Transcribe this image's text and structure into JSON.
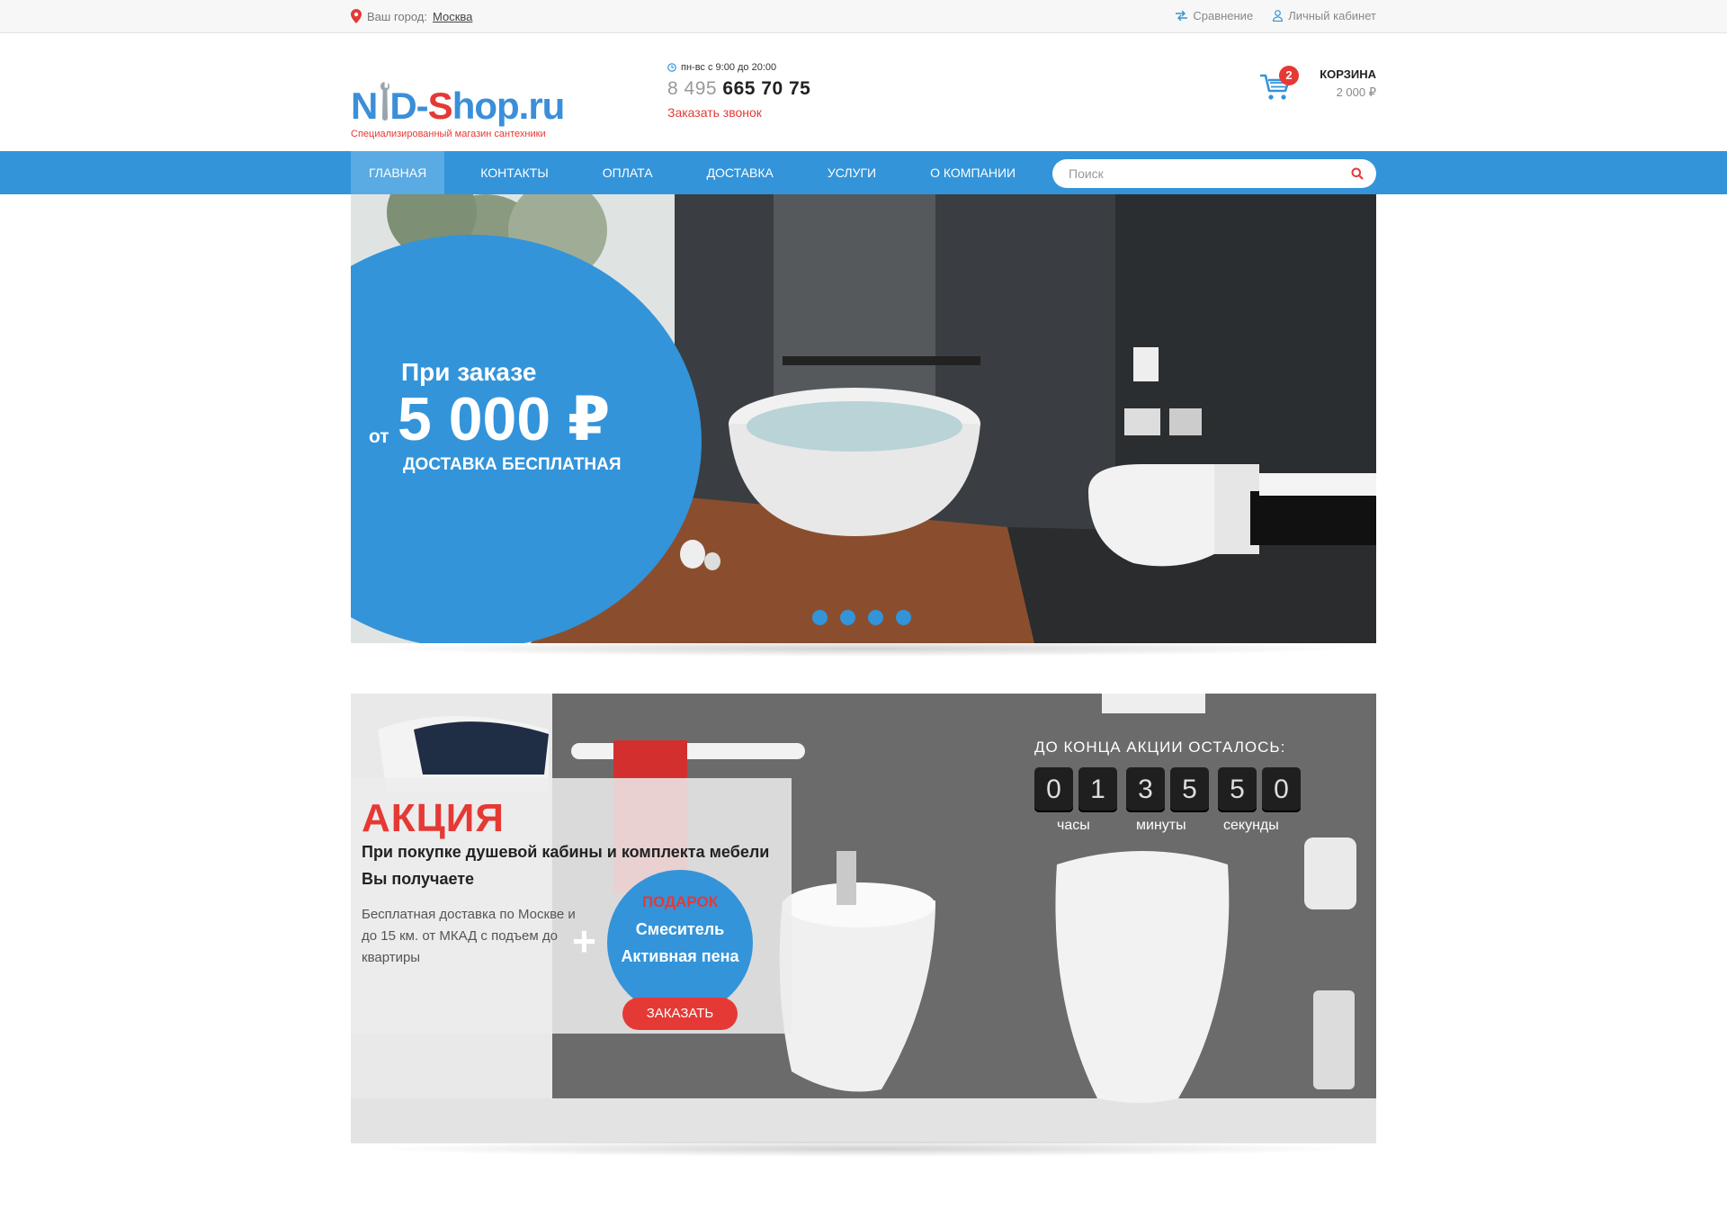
{
  "topbar": {
    "city_label": "Ваш город:",
    "city_value": "Москва",
    "compare": "Сравнение",
    "account": "Личный кабинет"
  },
  "header": {
    "logo_n": "N",
    "logo_d": "D-",
    "logo_s": "S",
    "logo_rest": "hop.ru",
    "logo_sub": "Специализированный магазин сантехники",
    "hours": "пн-вс с 9:00 до 20:00",
    "phone_code": "8 495",
    "phone_number": "665 70 75",
    "callback": "Заказать звонок",
    "cart_count": "2",
    "cart_title": "КОРЗИНА",
    "cart_sum": "2 000 ₽"
  },
  "nav": {
    "items": [
      {
        "label": "ГЛАВНАЯ"
      },
      {
        "label": "КОНТАКТЫ"
      },
      {
        "label": "ОПЛАТА"
      },
      {
        "label": "ДОСТАВКА"
      },
      {
        "label": "УСЛУГИ"
      },
      {
        "label": "О КОМПАНИИ"
      }
    ],
    "search_placeholder": "Поиск"
  },
  "hero": {
    "line1": "При заказе",
    "from": "от",
    "amount": "5 000 ₽",
    "line3": "ДОСТАВКА БЕСПЛАТНАЯ",
    "slides": 4
  },
  "promo": {
    "title": "АКЦИЯ",
    "line1": "При покупке душевой кабины и комплекта мебели",
    "line2": "Вы получаете",
    "desc": "Бесплатная доставка по Москве и до 15 км. от МКАД с подъем до квартиры",
    "plus": "+",
    "gift_title": "ПОДАРОК",
    "gift_1": "Смеситель",
    "gift_2": "Активная пена",
    "order": "ЗАКАЗАТЬ",
    "timer_title": "ДО КОНЦА АКЦИИ ОСТАЛОСЬ:",
    "digits": [
      "0",
      "1",
      "3",
      "5",
      "5",
      "0"
    ],
    "hours_label": "часы",
    "minutes_label": "минуты",
    "seconds_label": "секунды"
  },
  "colors": {
    "accent": "#3394da",
    "red": "#e53935"
  }
}
